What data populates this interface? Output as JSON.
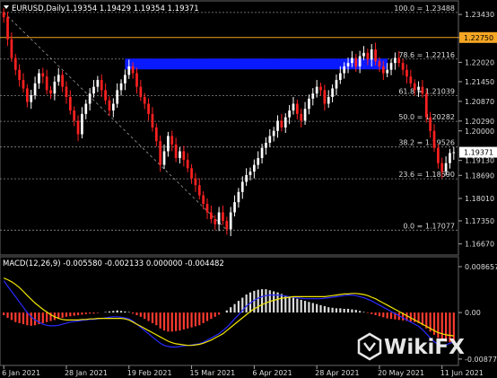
{
  "header": {
    "symbol_label": "EURUSD,Daily",
    "ohlc": "1.19354 1.19429 1.19354 1.19371"
  },
  "chart_data": {
    "type": "candlestick",
    "price_axis": {
      "ylim": [
        1.1645,
        1.2375
      ],
      "ticks": [
        "1.23430",
        "1.22750",
        "1.22020",
        "1.21450",
        "1.20870",
        "1.20290",
        "1.20000",
        "1.19130",
        "1.18690",
        "1.18010",
        "1.17350",
        "1.16670"
      ],
      "tick_values": [
        1.2343,
        1.2275,
        1.2202,
        1.2145,
        1.2087,
        1.2029,
        1.2,
        1.1913,
        1.1869,
        1.1801,
        1.1735,
        1.1667
      ],
      "current_price_label": "1.19371",
      "current_price": 1.19371,
      "highlight_level_label": "1.22750",
      "highlight_level": 1.2275,
      "highlight_color": "#f5a623"
    },
    "fibonacci": [
      {
        "label": "100.0 = 1.23488",
        "value": 1.23488
      },
      {
        "label": "78.6 = 1.22116",
        "value": 1.22116
      },
      {
        "label": "61.8 = 1.21039",
        "value": 1.21039
      },
      {
        "label": "50.0 = 1.20282",
        "value": 1.20282
      },
      {
        "label": "38.2 = 1.19526",
        "value": 1.19526
      },
      {
        "label": "23.6 = 1.18590",
        "value": 1.1859
      },
      {
        "label": "0.0 = 1.17077",
        "value": 1.17077
      }
    ],
    "zone": {
      "from": 1.2194,
      "to": 1.2213,
      "color": "#0a1aff"
    },
    "x_labels": [
      "6 Jan 2021",
      "28 Jan 2021",
      "19 Feb 2021",
      "15 Mar 2021",
      "6 Apr 2021",
      "28 Apr 2021",
      "20 May 2021",
      "11 Jun 2021"
    ],
    "x_label_index": [
      0,
      16,
      32,
      48,
      64,
      80,
      96,
      112
    ],
    "candles_close": [
      1.2335,
      1.227,
      1.2215,
      1.218,
      1.215,
      1.2125,
      1.2085,
      1.2105,
      1.214,
      1.217,
      1.216,
      1.212,
      1.211,
      1.2145,
      1.2165,
      1.213,
      1.21,
      1.206,
      1.203,
      1.199,
      1.205,
      1.208,
      1.211,
      1.213,
      1.215,
      1.212,
      1.209,
      1.206,
      1.208,
      1.212,
      1.214,
      1.2165,
      1.219,
      1.217,
      1.213,
      1.21,
      1.208,
      1.205,
      1.201,
      1.197,
      1.19,
      1.194,
      1.1985,
      1.196,
      1.192,
      1.194,
      1.1915,
      1.189,
      1.186,
      1.184,
      1.181,
      1.1785,
      1.176,
      1.174,
      1.1725,
      1.176,
      1.1735,
      1.171,
      1.176,
      1.179,
      1.182,
      1.185,
      1.187,
      1.188,
      1.19,
      1.192,
      1.195,
      1.1965,
      1.1985,
      1.2,
      1.203,
      1.201,
      1.204,
      1.206,
      1.208,
      1.205,
      1.203,
      1.2065,
      1.2095,
      1.211,
      1.213,
      1.212,
      1.208,
      1.21,
      1.2125,
      1.215,
      1.217,
      1.219,
      1.22,
      1.2215,
      1.219,
      1.222,
      1.223,
      1.221,
      1.224,
      1.2205,
      1.219,
      1.217,
      1.218,
      1.22,
      1.2215,
      1.22,
      1.218,
      1.216,
      1.214,
      1.212,
      1.213,
      1.211,
      1.204,
      1.2,
      1.195,
      1.1905,
      1.188,
      1.1905,
      1.1935,
      1.19371
    ],
    "macd": {
      "label": "MACD(12,26,9) -0.005580 -0.002133 0.000000 -0.004482",
      "ticks": [
        "0.008657",
        "0.00",
        "-0.008775"
      ],
      "tick_values": [
        0.008657,
        0.0,
        -0.008775
      ],
      "ylim": [
        -0.0093,
        0.0095
      ],
      "hist_color_pos": "#dddddd",
      "hist_color_neg": "#ff3b30",
      "signal_color": "#f2e600",
      "main_color": "#2a2aff",
      "histogram": [
        -0.0005,
        -0.001,
        -0.0014,
        -0.0018,
        -0.002,
        -0.0022,
        -0.0024,
        -0.0025,
        -0.0024,
        -0.0022,
        -0.002,
        -0.0018,
        -0.0016,
        -0.0014,
        -0.0012,
        -0.001,
        -0.0008,
        -0.0007,
        -0.0006,
        -0.0005,
        -0.0004,
        -0.0003,
        -0.0002,
        -0.0002,
        -0.0001,
        0.0,
        0.0001,
        0.0002,
        0.0003,
        0.0004,
        0.0003,
        0.0002,
        0.0001,
        -0.0002,
        -0.0005,
        -0.0008,
        -0.0012,
        -0.0016,
        -0.002,
        -0.0024,
        -0.003,
        -0.0034,
        -0.0036,
        -0.0036,
        -0.0035,
        -0.0034,
        -0.0032,
        -0.003,
        -0.0028,
        -0.0026,
        -0.0024,
        -0.002,
        -0.0016,
        -0.0012,
        -0.0008,
        -0.0004,
        0.0,
        0.0004,
        0.001,
        0.0016,
        0.0022,
        0.0028,
        0.0034,
        0.0038,
        0.0041,
        0.0043,
        0.0044,
        0.0044,
        0.0042,
        0.004,
        0.0038,
        0.0035,
        0.0032,
        0.003,
        0.0028,
        0.0026,
        0.0024,
        0.0022,
        0.002,
        0.0018,
        0.0016,
        0.0014,
        0.0012,
        0.001,
        0.0009,
        0.0008,
        0.0008,
        0.0007,
        0.0007,
        0.0006,
        0.0005,
        0.0003,
        0.0001,
        -0.0001,
        -0.0003,
        -0.0005,
        -0.0007,
        -0.0009,
        -0.0011,
        -0.0012,
        -0.0013,
        -0.0014,
        -0.0015,
        -0.0016,
        -0.0017,
        -0.0018,
        -0.002,
        -0.0024,
        -0.003,
        -0.0036,
        -0.0042,
        -0.0048,
        -0.0052,
        -0.0055,
        -0.0056,
        -0.005558
      ],
      "main": [
        0.006,
        0.005,
        0.004,
        0.003,
        0.002,
        0.001,
        0.0,
        -0.0008,
        -0.0014,
        -0.0018,
        -0.0022,
        -0.0024,
        -0.0025,
        -0.0025,
        -0.0024,
        -0.0022,
        -0.002,
        -0.0018,
        -0.0017,
        -0.0016,
        -0.0015,
        -0.0014,
        -0.0013,
        -0.0013,
        -0.0012,
        -0.0011,
        -0.001,
        -0.0009,
        -0.0008,
        -0.0008,
        -0.0009,
        -0.001,
        -0.0012,
        -0.0016,
        -0.0022,
        -0.0028,
        -0.0034,
        -0.004,
        -0.0046,
        -0.0052,
        -0.0058,
        -0.0062,
        -0.0064,
        -0.0065,
        -0.0065,
        -0.0064,
        -0.0063,
        -0.0062,
        -0.0061,
        -0.006,
        -0.0059,
        -0.0056,
        -0.0052,
        -0.0048,
        -0.0044,
        -0.004,
        -0.0034,
        -0.0028,
        -0.002,
        -0.0012,
        -0.0004,
        0.0004,
        0.0012,
        0.0018,
        0.0023,
        0.0027,
        0.003,
        0.0032,
        0.0033,
        0.0033,
        0.0033,
        0.0032,
        0.0031,
        0.003,
        0.0029,
        0.0028,
        0.0027,
        0.0026,
        0.0026,
        0.0026,
        0.0026,
        0.0026,
        0.0027,
        0.0028,
        0.0029,
        0.003,
        0.0031,
        0.0032,
        0.0033,
        0.0033,
        0.0032,
        0.003,
        0.0028,
        0.0025,
        0.0022,
        0.0018,
        0.0014,
        0.001,
        0.0006,
        0.0002,
        -0.0002,
        -0.0006,
        -0.001,
        -0.0014,
        -0.0018,
        -0.0022,
        -0.0026,
        -0.0032,
        -0.004,
        -0.0048,
        -0.0055,
        -0.006,
        -0.0062,
        -0.0061,
        -0.0058,
        -0.0056
      ],
      "signal": [
        0.0065,
        0.0062,
        0.0058,
        0.0053,
        0.0047,
        0.004,
        0.0032,
        0.0025,
        0.0018,
        0.0012,
        0.0006,
        0.0001,
        -0.0004,
        -0.0008,
        -0.0011,
        -0.0013,
        -0.0014,
        -0.0014,
        -0.0014,
        -0.0014,
        -0.0013,
        -0.0013,
        -0.0012,
        -0.0012,
        -0.0011,
        -0.0011,
        -0.0011,
        -0.0011,
        -0.0011,
        -0.0011,
        -0.0011,
        -0.0012,
        -0.0014,
        -0.0018,
        -0.0022,
        -0.0026,
        -0.003,
        -0.0034,
        -0.0038,
        -0.0042,
        -0.0046,
        -0.005,
        -0.0054,
        -0.0057,
        -0.0059,
        -0.006,
        -0.0061,
        -0.0062,
        -0.0062,
        -0.0061,
        -0.006,
        -0.0058,
        -0.0055,
        -0.0052,
        -0.0048,
        -0.0044,
        -0.004,
        -0.0034,
        -0.0028,
        -0.0022,
        -0.0016,
        -0.001,
        -0.0004,
        0.0002,
        0.0007,
        0.0011,
        0.0015,
        0.0018,
        0.0021,
        0.0023,
        0.0025,
        0.0027,
        0.0028,
        0.0029,
        0.003,
        0.003,
        0.003,
        0.003,
        0.003,
        0.003,
        0.003,
        0.003,
        0.003,
        0.0031,
        0.0032,
        0.0033,
        0.0034,
        0.0035,
        0.0035,
        0.0036,
        0.0036,
        0.0035,
        0.0034,
        0.0032,
        0.0029,
        0.0026,
        0.0022,
        0.0018,
        0.0014,
        0.001,
        0.0006,
        0.0002,
        -0.0002,
        -0.0006,
        -0.001,
        -0.0014,
        -0.0018,
        -0.0022,
        -0.0026,
        -0.003,
        -0.0034,
        -0.0038,
        -0.004,
        -0.0042,
        -0.0043,
        -0.0044
      ]
    }
  },
  "watermark": {
    "text": "WikiFX"
  }
}
